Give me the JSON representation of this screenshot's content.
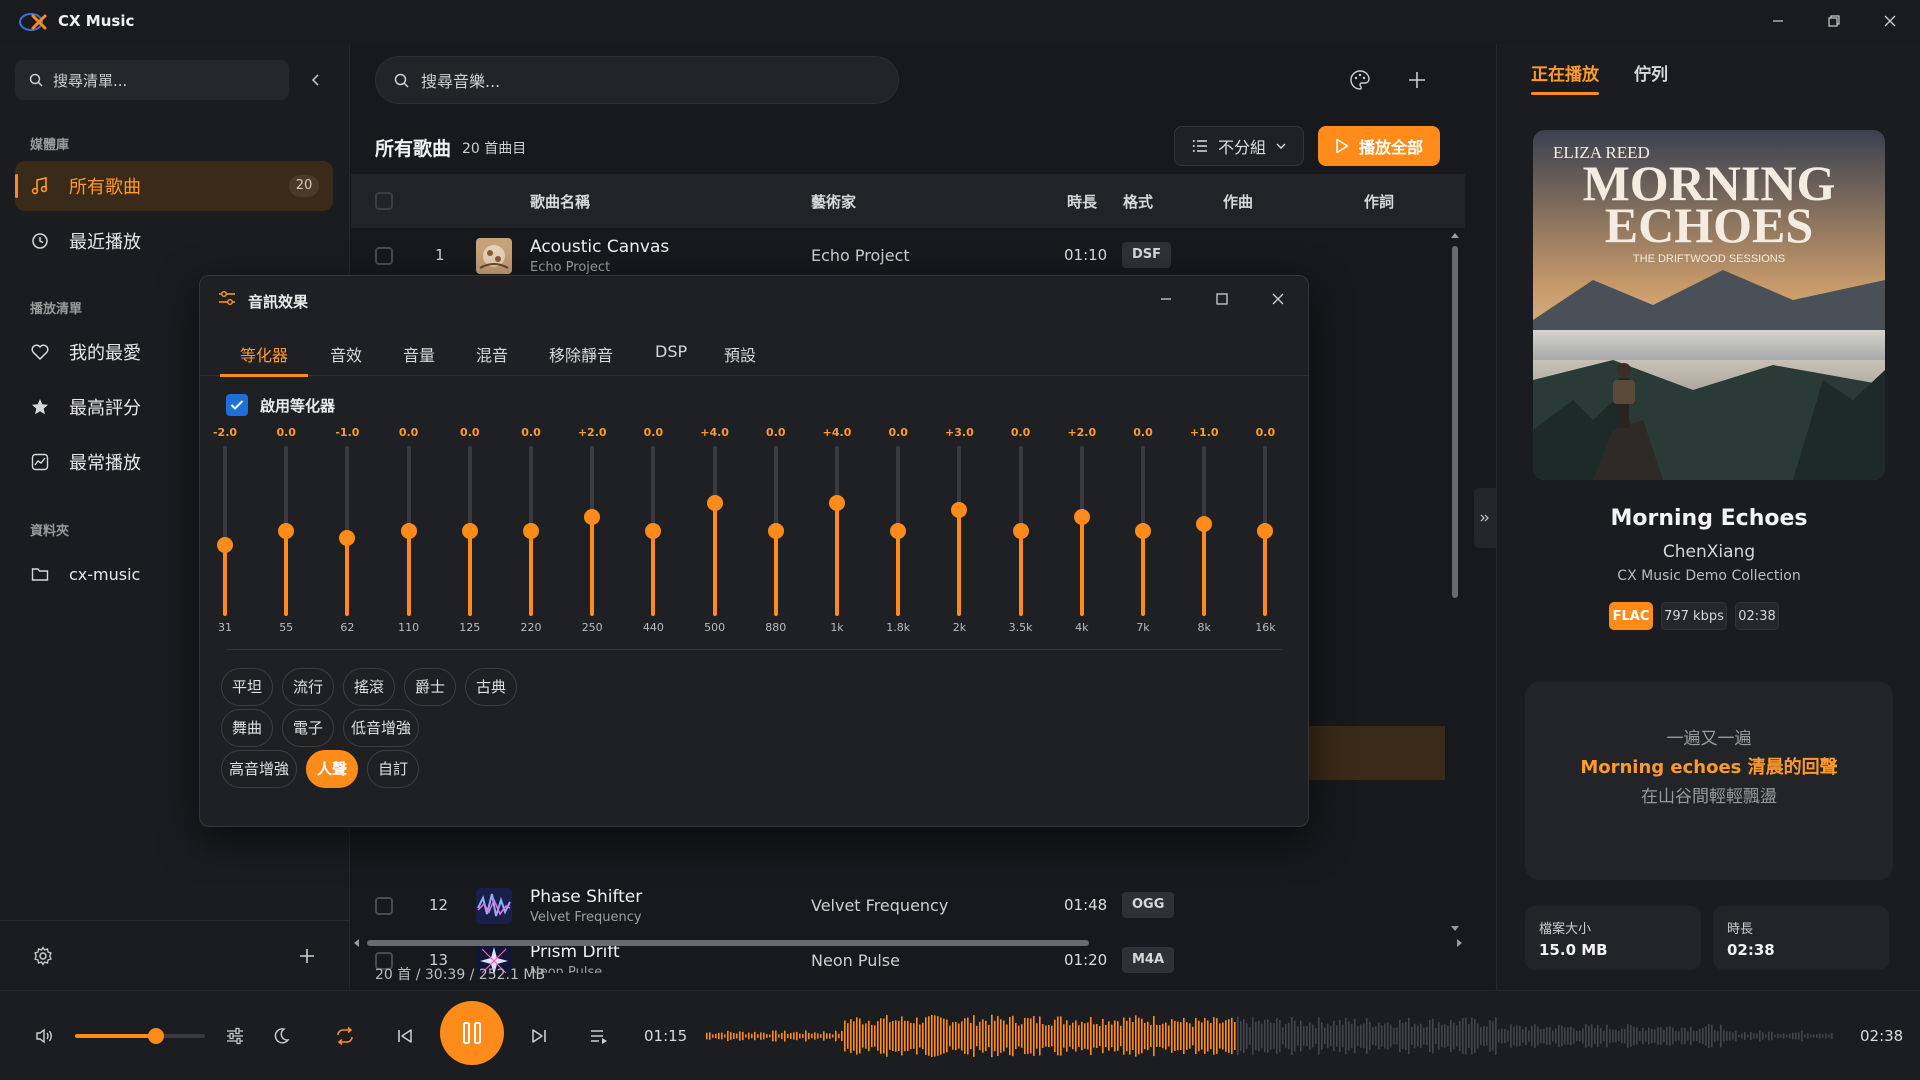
{
  "app": {
    "title": "CX Music"
  },
  "sidebar": {
    "search_placeholder": "搜尋清單...",
    "library_label": "媒體庫",
    "items": [
      {
        "label": "所有歌曲",
        "count": "20",
        "icon": "music-note-icon"
      },
      {
        "label": "最近播放",
        "icon": "clock-icon"
      }
    ],
    "playlists_label": "播放清單",
    "playlists": [
      {
        "label": "我的最愛",
        "icon": "heart-icon"
      },
      {
        "label": "最高評分",
        "icon": "star-icon"
      },
      {
        "label": "最常播放",
        "icon": "chart-icon"
      }
    ],
    "folders_label": "資料夾",
    "folders": [
      {
        "label": "cx-music",
        "icon": "folder-icon"
      }
    ]
  },
  "main": {
    "search_placeholder": "搜尋音樂...",
    "list_title": "所有歌曲",
    "list_count": "20 首曲目",
    "group_label": "不分組",
    "play_all_label": "播放全部",
    "columns": {
      "title": "歌曲名稱",
      "artist": "藝術家",
      "duration": "時長",
      "format": "格式",
      "composer": "作曲",
      "lyricist": "作詞"
    },
    "rows": [
      {
        "num": "1",
        "title": "Acoustic Canvas",
        "album": "Echo Project",
        "artist": "Echo Project",
        "duration": "01:10",
        "format": "DSF"
      },
      {
        "num": "12",
        "title": "Phase Shifter",
        "album": "Velvet Frequency",
        "artist": "Velvet Frequency",
        "duration": "01:48",
        "format": "OGG"
      },
      {
        "num": "13",
        "title": "Prism Drift",
        "album": "Neon Pulse",
        "artist": "Neon Pulse",
        "duration": "01:20",
        "format": "M4A"
      }
    ],
    "status": "20 首 / 30:39 / 252.1 MB"
  },
  "now_playing": {
    "tabs": [
      "正在播放",
      "佇列"
    ],
    "album_art_text": {
      "artist": "ELIZA REED",
      "line1": "MORNING",
      "line2": "ECHOES",
      "subtitle": "THE DRIFTWOOD SESSIONS"
    },
    "title": "Morning Echoes",
    "artist": "ChenXiang",
    "album": "CX Music Demo Collection",
    "badges": {
      "format": "FLAC",
      "bitrate": "797 kbps",
      "duration": "02:38"
    },
    "lyrics": {
      "prev": "一遍又一遍",
      "current": "Morning echoes 清晨的回聲",
      "next": "在山谷間輕輕飄盪"
    },
    "info": {
      "size_label": "檔案大小",
      "size": "15.0 MB",
      "duration_label": "時長",
      "duration": "02:38"
    }
  },
  "player": {
    "current_time": "01:15",
    "total_time": "02:38",
    "volume": 0.62,
    "progress": 0.47
  },
  "fx": {
    "title": "音訊效果",
    "tabs": [
      "等化器",
      "音效",
      "音量",
      "混音",
      "移除靜音",
      "DSP",
      "預設"
    ],
    "enable_label": "啟用等化器",
    "range_db": 12,
    "bands": [
      {
        "freq": "31",
        "gain": "-2.0"
      },
      {
        "freq": "55",
        "gain": "0.0"
      },
      {
        "freq": "62",
        "gain": "-1.0"
      },
      {
        "freq": "110",
        "gain": "0.0"
      },
      {
        "freq": "125",
        "gain": "0.0"
      },
      {
        "freq": "220",
        "gain": "0.0"
      },
      {
        "freq": "250",
        "gain": "+2.0"
      },
      {
        "freq": "440",
        "gain": "0.0"
      },
      {
        "freq": "500",
        "gain": "+4.0"
      },
      {
        "freq": "880",
        "gain": "0.0"
      },
      {
        "freq": "1k",
        "gain": "+4.0"
      },
      {
        "freq": "1.8k",
        "gain": "0.0"
      },
      {
        "freq": "2k",
        "gain": "+3.0"
      },
      {
        "freq": "3.5k",
        "gain": "0.0"
      },
      {
        "freq": "4k",
        "gain": "+2.0"
      },
      {
        "freq": "7k",
        "gain": "0.0"
      },
      {
        "freq": "8k",
        "gain": "+1.0"
      },
      {
        "freq": "16k",
        "gain": "0.0"
      }
    ],
    "presets": [
      "平坦",
      "流行",
      "搖滾",
      "爵士",
      "古典",
      "舞曲",
      "電子",
      "低音增強",
      "高音增強",
      "人聲",
      "自訂"
    ],
    "active_preset": "人聲"
  },
  "colors": {
    "accent": "#ff8c1a",
    "check": "#1e6fd9"
  }
}
